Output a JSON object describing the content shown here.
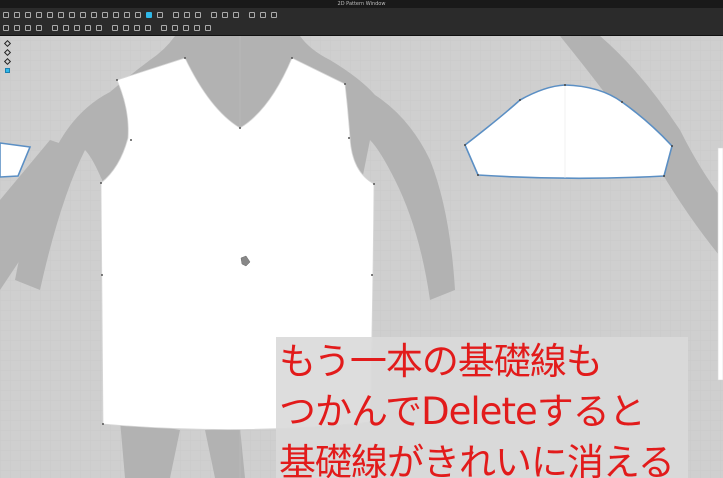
{
  "window": {
    "title": "2D Pattern Window"
  },
  "toolbar": {
    "row1_tools": [
      "edit-pattern",
      "edit-point",
      "edit-curvature",
      "edit-curve-point",
      "add-point",
      "transform-pattern",
      "polygon",
      "rectangle",
      "circle",
      "internal-polygon",
      "internal-rectangle",
      "internal-circle",
      "create-dart",
      "trace",
      "sewing",
      "segment-sewing",
      "free-sewing",
      "annotation",
      "text",
      "graphic",
      "button",
      "buttonhole",
      "topstitch",
      "puckering"
    ],
    "row2_tools": [
      "baseline",
      "internal-line",
      "unfold",
      "auto-seam",
      "fold",
      "shirring",
      "elastic",
      "fabric-grain",
      "pin",
      "measure",
      "check-length",
      "ruler",
      "grading",
      "symmetry",
      "fit",
      "zoom",
      "pan",
      "arrange"
    ],
    "active_tool": "graphic"
  },
  "sidebar": {
    "tools": [
      "select",
      "transform",
      "zoom",
      "pin"
    ],
    "active_tool": "pin"
  },
  "caption": {
    "line1": "もう一本の基礎線も",
    "line2": "つかんでDeleteすると",
    "line3": "基礎線がきれいに消える",
    "color": "#e21b1b"
  },
  "colors": {
    "canvas": "#cfcfcf",
    "avatar_silhouette": "#b2b2b2",
    "pattern_fill": "#ffffff",
    "selected_outline": "#5b8fc4"
  },
  "patterns": [
    "front-bodice",
    "sleeve-right",
    "sleeve-left-partial",
    "back-partial"
  ]
}
